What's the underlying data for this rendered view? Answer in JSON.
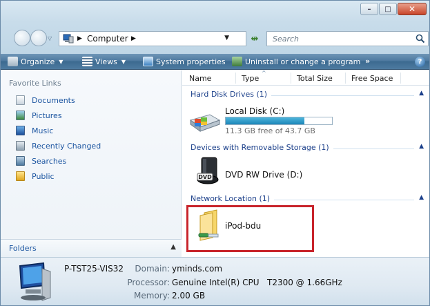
{
  "address_bar": {
    "crumbs": [
      "Computer"
    ],
    "search_placeholder": "Search"
  },
  "toolbar": {
    "organize": "Organize",
    "views": "Views",
    "system_properties": "System properties",
    "uninstall": "Uninstall or change a program",
    "more": "»",
    "help": "?"
  },
  "nav_pane": {
    "favorites_title": "Favorite Links",
    "favorites": [
      {
        "label": "Documents",
        "icon": "documents-icon"
      },
      {
        "label": "Pictures",
        "icon": "pictures-icon"
      },
      {
        "label": "Music",
        "icon": "music-icon"
      },
      {
        "label": "Recently Changed",
        "icon": "recently-changed-icon"
      },
      {
        "label": "Searches",
        "icon": "searches-icon"
      },
      {
        "label": "Public",
        "icon": "public-folder-icon"
      }
    ],
    "folders_label": "Folders"
  },
  "columns": [
    "Name",
    "Type",
    "Total Size",
    "Free Space"
  ],
  "groups": {
    "hard_disks": {
      "label": "Hard Disk Drives (1)",
      "items": [
        {
          "name": "Local Disk (C:)",
          "free_text": "11.3 GB free of 43.7 GB",
          "used_fraction": 0.741
        }
      ]
    },
    "removable": {
      "label": "Devices with Removable Storage (1)",
      "items": [
        {
          "name": "DVD RW Drive (D:)",
          "badge": "DVD"
        }
      ]
    },
    "network": {
      "label": "Network Location (1)",
      "items": [
        {
          "name": "iPod-bdu"
        }
      ]
    }
  },
  "details": {
    "computer_name": "P-TST25-VIS32",
    "domain_label": "Domain:",
    "domain_value": "yminds.com",
    "processor_label": "Processor:",
    "processor_value": "Genuine Intel(R) CPU",
    "processor_model": "T2300 @ 1.66GHz",
    "memory_label": "Memory:",
    "memory_value": "2.00 GB"
  },
  "colors": {
    "toolbar": "#4f7aa0",
    "link": "#1b55a0",
    "group_header": "#1b3f8a",
    "capacity_fill": "#1c86b8",
    "highlight": "#c8242b"
  }
}
